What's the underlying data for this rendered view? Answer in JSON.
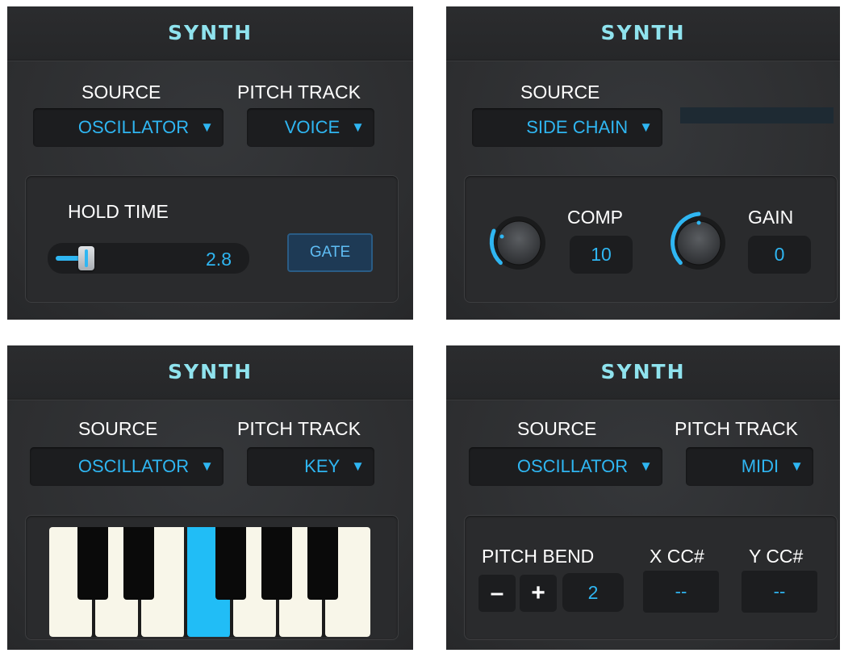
{
  "colors": {
    "accent": "#2fb6f2",
    "title": "#8fe3ee",
    "panel_bg": "#2f3031",
    "active_key": "#21bdf6"
  },
  "panels": [
    {
      "title": "SYNTH",
      "source_label": "SOURCE",
      "source_value": "OSCILLATOR",
      "pitch_track_label": "PITCH TRACK",
      "pitch_track_value": "VOICE",
      "hold_time_label": "HOLD TIME",
      "hold_time_value": "2.8",
      "gate_label": "GATE"
    },
    {
      "title": "SYNTH",
      "source_label": "SOURCE",
      "source_value": "SIDE CHAIN",
      "comp_label": "COMP",
      "comp_value": "10",
      "gain_label": "GAIN",
      "gain_value": "0"
    },
    {
      "title": "SYNTH",
      "source_label": "SOURCE",
      "source_value": "OSCILLATOR",
      "pitch_track_label": "PITCH TRACK",
      "pitch_track_value": "KEY",
      "white_keys": 7,
      "active_white_key": 3
    },
    {
      "title": "SYNTH",
      "source_label": "SOURCE",
      "source_value": "OSCILLATOR",
      "pitch_track_label": "PITCH TRACK",
      "pitch_track_value": "MIDI",
      "pitch_bend_label": "PITCH BEND",
      "minus_label": "–",
      "plus_label": "+",
      "pitch_bend_value": "2",
      "x_cc_label": "X CC#",
      "x_cc_value": "--",
      "y_cc_label": "Y CC#",
      "y_cc_value": "--"
    }
  ],
  "icons": {
    "dropdown_arrow": "▼"
  }
}
